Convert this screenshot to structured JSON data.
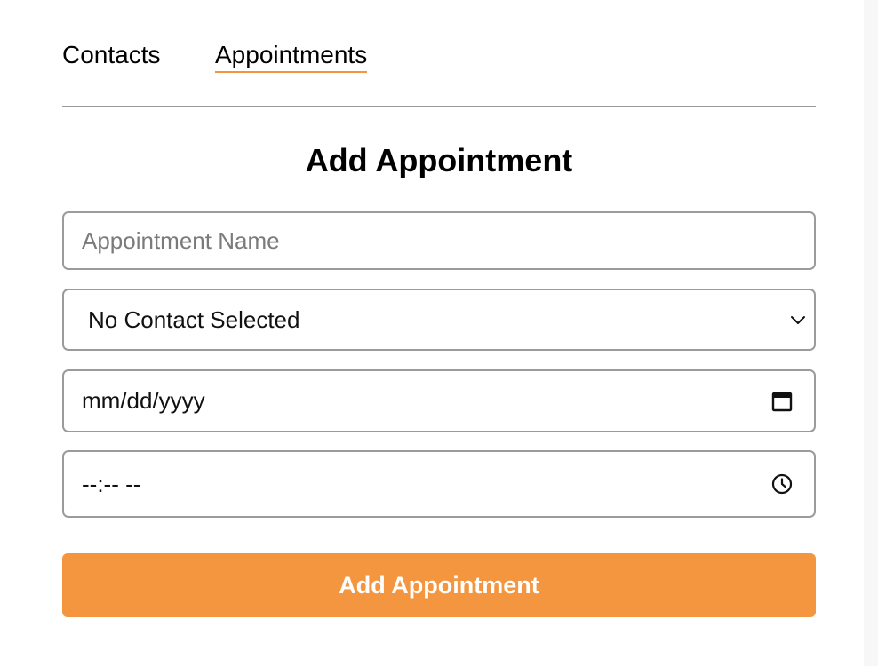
{
  "nav": {
    "contacts_label": "Contacts",
    "appointments_label": "Appointments",
    "active_tab": "Appointments",
    "active_underline_color": "#f4963f"
  },
  "form": {
    "heading": "Add Appointment",
    "name_placeholder": "Appointment Name",
    "contact_selected": "No Contact Selected",
    "date_placeholder": "mm/dd/yyyy",
    "time_placeholder": "--:-- --",
    "submit_label": "Add Appointment"
  },
  "icons": {
    "select_arrow": "chevron-down-icon",
    "date": "calendar-icon",
    "time": "clock-icon"
  },
  "colors": {
    "accent": "#f4963f",
    "border": "#9b9b9b"
  }
}
